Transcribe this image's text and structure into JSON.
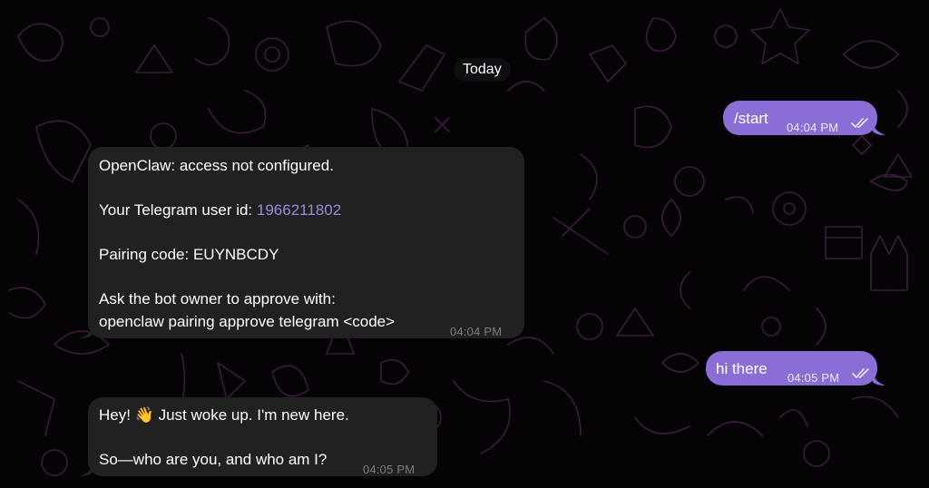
{
  "chat": {
    "date_separator": "Today",
    "messages": [
      {
        "direction": "outgoing",
        "text": "/start",
        "time": "04:04 PM",
        "read_status": "double-check-icon"
      },
      {
        "direction": "incoming",
        "line1": "OpenClaw: access not configured.",
        "line2_prefix": "Your Telegram user id: ",
        "line2_link": "1966211802",
        "line3": "Pairing code: EUYNBCDY",
        "line4": "Ask the bot owner to approve with:",
        "line5": "openclaw pairing approve telegram <code>",
        "time": "04:04 PM"
      },
      {
        "direction": "outgoing",
        "text": "hi there",
        "time": "04:05 PM",
        "read_status": "double-check-icon"
      },
      {
        "direction": "incoming",
        "line1": "Hey! 👋 Just woke up. I'm new here.",
        "line2": "So—who are you, and who am I?",
        "time": "04:05 PM"
      }
    ]
  },
  "colors": {
    "background": "#050306",
    "doodle": "#3a1d3c",
    "incoming_bubble": "#212121",
    "outgoing_bubble": "#8a6ed6",
    "link": "#9d89e3"
  }
}
